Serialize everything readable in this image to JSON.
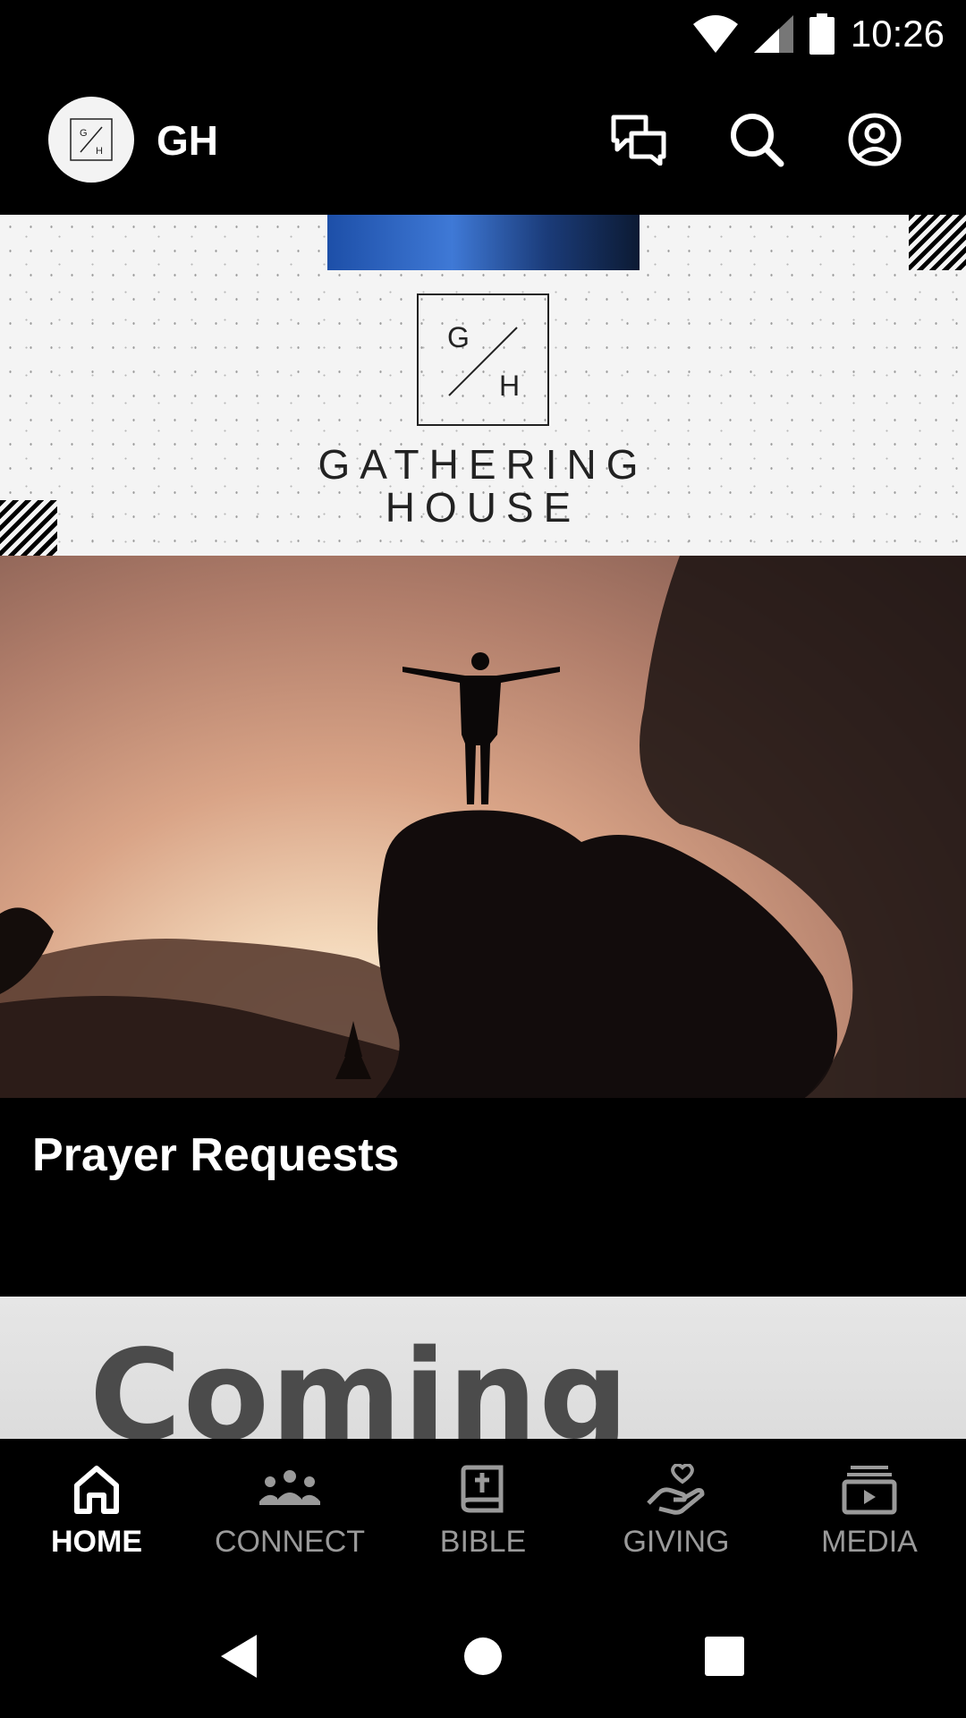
{
  "status_bar": {
    "time": "10:26"
  },
  "header": {
    "logo_text": "G/H",
    "title": "GH"
  },
  "banner": {
    "line1": "GATHERING",
    "line2": "HOUSE",
    "mark_top": "G",
    "mark_bottom": "H"
  },
  "card": {
    "title": "Prayer Requests"
  },
  "peek": {
    "text": "Coming"
  },
  "nav": {
    "items": [
      {
        "label": "HOME",
        "icon": "home-icon",
        "active": true
      },
      {
        "label": "CONNECT",
        "icon": "people-icon",
        "active": false
      },
      {
        "label": "BIBLE",
        "icon": "bible-icon",
        "active": false
      },
      {
        "label": "GIVING",
        "icon": "giving-hand-icon",
        "active": false
      },
      {
        "label": "MEDIA",
        "icon": "media-play-icon",
        "active": false
      }
    ]
  }
}
